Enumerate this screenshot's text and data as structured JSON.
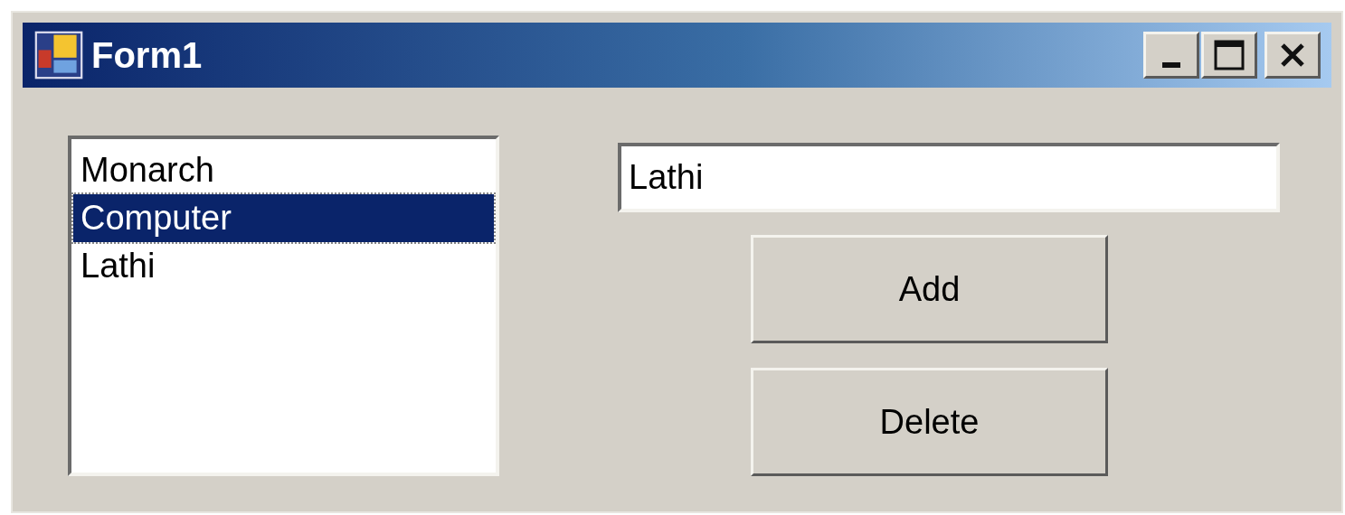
{
  "window": {
    "title": "Form1"
  },
  "list": {
    "items": [
      {
        "label": "Monarch",
        "selected": false
      },
      {
        "label": "Computer",
        "selected": true
      },
      {
        "label": "Lathi",
        "selected": false
      }
    ]
  },
  "text_field": {
    "value": "Lathi"
  },
  "buttons": [
    "Add",
    "Delete"
  ]
}
